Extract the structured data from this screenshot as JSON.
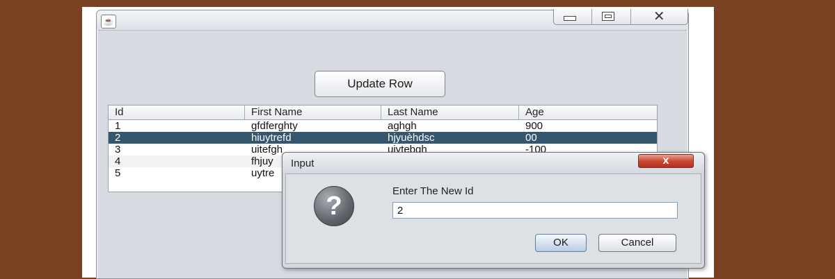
{
  "window": {
    "app_icon": "java-cup-icon",
    "minimize_icon": "minimize-icon",
    "maximize_icon": "maximize-icon",
    "close_glyph": "✕"
  },
  "toolbar": {
    "update_label": "Update Row"
  },
  "table": {
    "columns": [
      "Id",
      "First Name",
      "Last Name",
      "Age"
    ],
    "rows": [
      [
        "1",
        "gfdferghty",
        "aghgh",
        "900"
      ],
      [
        "2",
        "hiuytrefd",
        "hjyuèhdsc",
        "00"
      ],
      [
        "3",
        "uitefgh",
        "uiytebgh",
        "-100"
      ],
      [
        "4",
        "fhjuy",
        "",
        ""
      ],
      [
        "5",
        "uytre",
        "",
        ""
      ]
    ],
    "selected_row": 2
  },
  "dialog": {
    "title": "Input",
    "close_glyph": "x",
    "icon": "question-icon",
    "icon_glyph": "?",
    "prompt": "Enter The New Id",
    "input_value": "2",
    "ok_label": "OK",
    "cancel_label": "Cancel"
  },
  "colors": {
    "background": "#7a4022",
    "selection": "#34566f",
    "close_button": "#c7452f"
  }
}
